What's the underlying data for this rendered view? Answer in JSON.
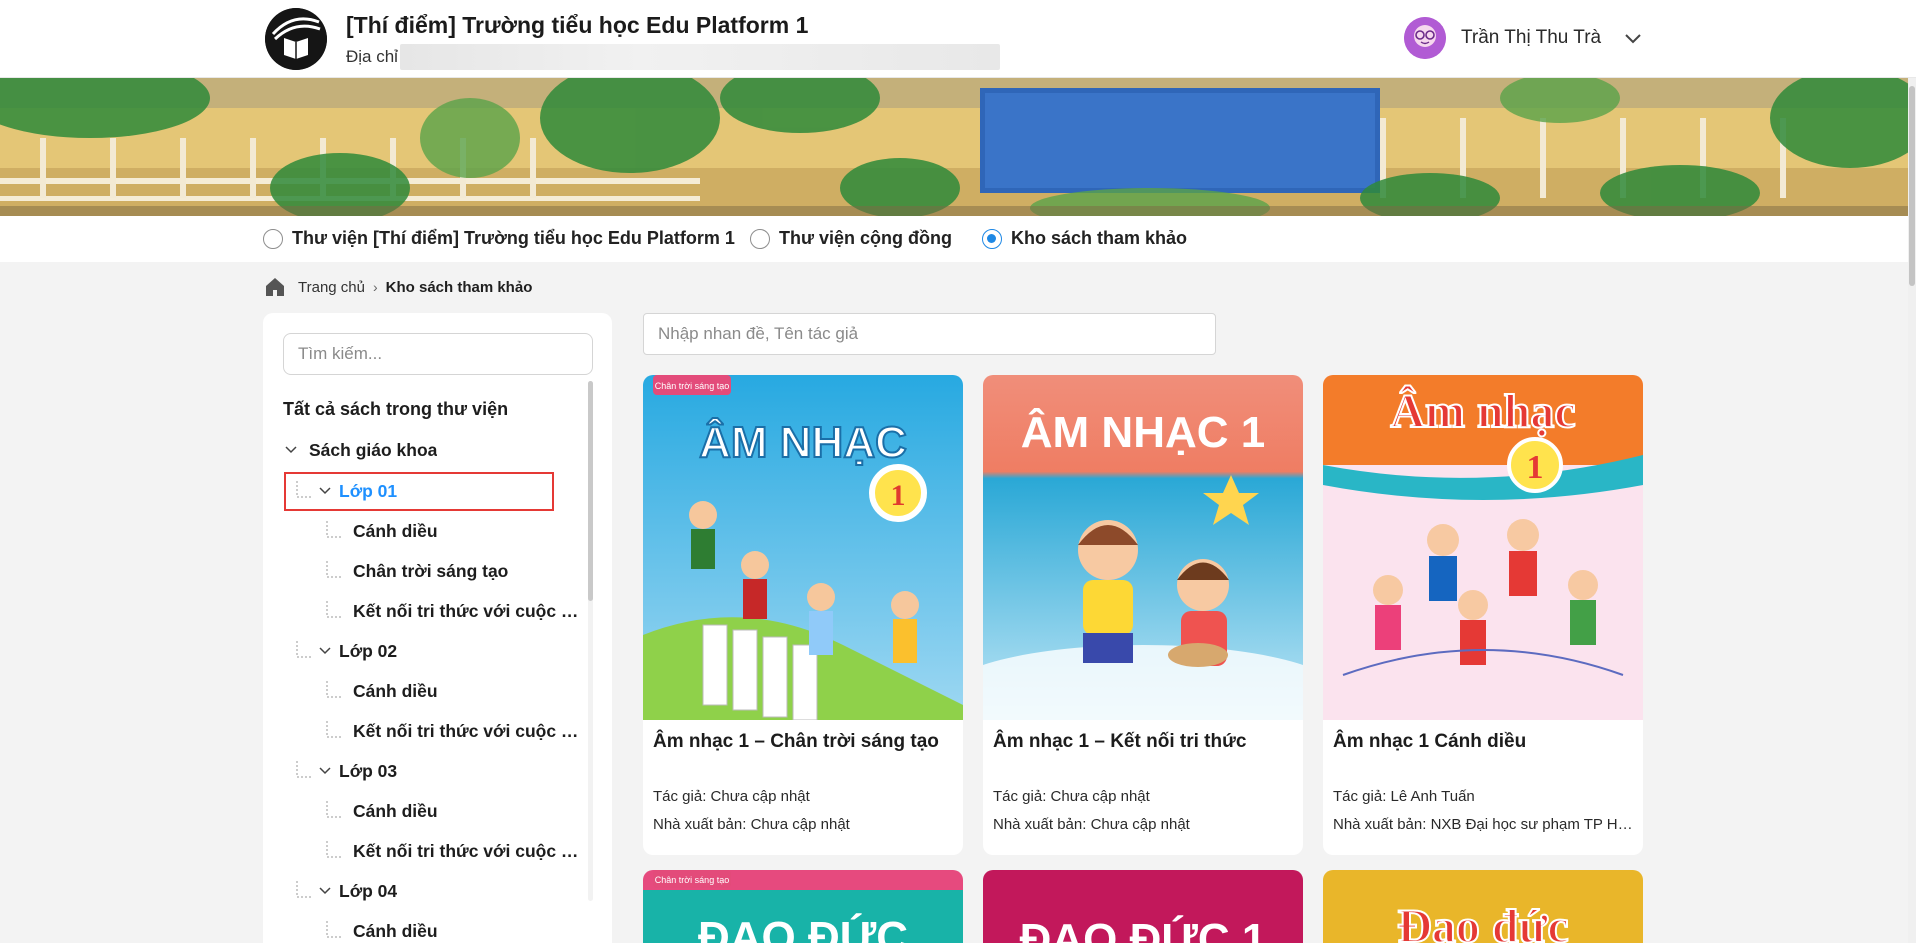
{
  "header": {
    "school_name": "[Thí điểm] Trường tiểu học Edu Platform 1",
    "address_label": "Địa chỉ",
    "user_name": "Trần Thị Thu Trà"
  },
  "libraries": [
    {
      "label": "Thư viện [Thí điểm] Trường tiểu học Edu Platform 1",
      "selected": false
    },
    {
      "label": "Thư viện cộng đồng",
      "selected": false
    },
    {
      "label": "Kho sách tham khảo",
      "selected": true
    }
  ],
  "breadcrumb": {
    "home": "Trang chủ",
    "current": "Kho sách tham khảo"
  },
  "tree": {
    "search_placeholder": "Tìm kiếm...",
    "root": "Tất cả sách trong thư viện",
    "category": "Sách giáo khoa",
    "items": [
      {
        "label": "Lớp 01"
      },
      {
        "label": "Cánh diều"
      },
      {
        "label": "Chân trời sáng tạo"
      },
      {
        "label": "Kết nối tri thức với cuộc s..."
      },
      {
        "label": "Lớp 02"
      },
      {
        "label": "Cánh diều"
      },
      {
        "label": "Kết nối tri thức với cuộc s..."
      },
      {
        "label": "Lớp 03"
      },
      {
        "label": "Cánh diều"
      },
      {
        "label": "Kết nối tri thức với cuộc s..."
      },
      {
        "label": "Lớp 04"
      },
      {
        "label": "Cánh diều"
      }
    ]
  },
  "main": {
    "search_placeholder": "Nhập nhan đề, Tên tác giả",
    "books": [
      {
        "title": "Âm nhạc 1 – Chân trời sáng tạo",
        "author": "Tác giả: Chưa cập nhật",
        "publisher": "Nhà xuất bản: Chưa cập nhật",
        "cover_text": "ÂM NHẠC",
        "cover_number": "1",
        "series_badge": "Chân trời sáng tạo"
      },
      {
        "title": "Âm nhạc 1 – Kết nối tri thức",
        "author": "Tác giả: Chưa cập nhật",
        "publisher": "Nhà xuất bản: Chưa cập nhật",
        "cover_text": "ÂM NHẠC 1"
      },
      {
        "title": "Âm nhạc 1 Cánh diều",
        "author": "Tác giả: Lê Anh Tuấn",
        "publisher": "Nhà xuất bản: NXB Đại học sư phạm TP Hồ...",
        "cover_text": "Âm nhạc",
        "cover_number": "1"
      }
    ],
    "next_row_covers": [
      {
        "cover_text": "ĐẠO ĐỨC",
        "series_badge": "Chân trời sáng tạo"
      },
      {
        "cover_text": "ĐẠO ĐỨC 1"
      },
      {
        "cover_text": "Đạo đức"
      }
    ]
  },
  "colors": {
    "accent": "#1e88e5",
    "selected_tree": "#1e90ff",
    "highlight": "#e53935"
  }
}
